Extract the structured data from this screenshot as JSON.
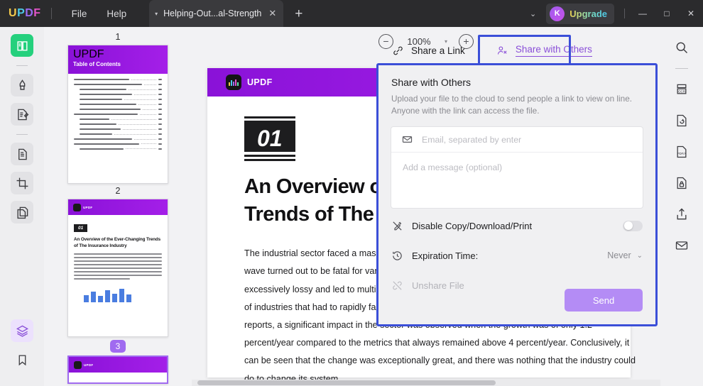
{
  "titlebar": {
    "logo": [
      "U",
      "P",
      "D",
      "F"
    ],
    "menus": [
      {
        "label": "File",
        "name": "menu-file"
      },
      {
        "label": "Help",
        "name": "menu-help"
      }
    ],
    "tab": {
      "name": "Helping-Out...al-Strength",
      "close": "✕",
      "caret": "▾"
    },
    "new_tab": "+",
    "chevron": "⌄",
    "account_initial": "K",
    "upgrade_label": "Upgrade",
    "window_buttons": {
      "minimize": "—",
      "maximize": "□",
      "close": "✕"
    }
  },
  "left_rail": {
    "items": [
      {
        "name": "sidebar-reader-icon",
        "state": "active"
      },
      {
        "name": "sidebar-annotate-icon",
        "state": "normal"
      },
      {
        "name": "sidebar-edit-pdf-icon",
        "state": "normal"
      },
      {
        "name": "sidebar-organize-pages-icon",
        "state": "normal"
      },
      {
        "name": "sidebar-crop-icon",
        "state": "normal"
      },
      {
        "name": "sidebar-convert-icon",
        "state": "normal"
      }
    ],
    "bottom": [
      {
        "name": "sidebar-layers-icon",
        "state": "purple"
      },
      {
        "name": "sidebar-bookmark-icon",
        "state": "plain"
      }
    ]
  },
  "right_rail": {
    "items": [
      {
        "name": "search-icon"
      },
      {
        "name": "ocr-icon"
      },
      {
        "name": "convert-pdf-icon"
      },
      {
        "name": "pdf-a-icon"
      },
      {
        "name": "protect-icon"
      },
      {
        "name": "share-export-icon"
      },
      {
        "name": "email-icon"
      }
    ]
  },
  "thumbnails": {
    "pages": [
      {
        "number": "1",
        "selected": false,
        "kind": "toc"
      },
      {
        "number": "2",
        "selected": false,
        "kind": "content"
      },
      {
        "number": "3",
        "selected": true,
        "kind": "content"
      }
    ],
    "toc_title": "Table of Contents",
    "mini_badge": "01",
    "mini_headline": "An Overview of the Ever-Changing Trends of The Insurance Industry"
  },
  "toolbar": {
    "zoom_out": "−",
    "zoom_level": "100%",
    "zoom_caret": "▾",
    "zoom_in": "+"
  },
  "document": {
    "brand": "UPDF",
    "section_number": "01",
    "headline_line1": "An Overview of the Ever-Changing",
    "headline_line2": "Trends of The Insurance Industry",
    "body": "The industrial sector faced a massive tremor with the advent of the COVID-19 wave. The deadly wave turned out to be fatal for various industries, where the pandemic panic and clampdown was excessively lossy and led to multiple changes in the sector. The line is evidently concerning the list of industries that had to rapidly face the effects caused by the pandemic. According to a recent reports, a significant impact in the sector was observed when the growth was of only 1.2 percent/year compared to the metrics that always remained above 4 percent/year. Conclusively, it can be seen that the change was exceptionally great, and there was nothing that the industry could do to change its system."
  },
  "share": {
    "tabs": [
      {
        "label": "Share a Link",
        "icon": "link-icon",
        "active": false
      },
      {
        "label": "Share with Others",
        "icon": "share-people-icon",
        "active": true
      }
    ],
    "title": "Share with Others",
    "subtitle": "Upload your file to the cloud to send people a link to view on line. Anyone with the link can access the file.",
    "email_placeholder": "Email, separated by enter",
    "email_value": "",
    "message_placeholder": "Add a message (optional)",
    "message_value": "",
    "disable_copy_label": "Disable Copy/Download/Print",
    "disable_copy_state": "off",
    "expiration_label": "Expiration Time:",
    "expiration_value": "Never",
    "expiration_caret": "⌄",
    "unshare_label": "Unshare File",
    "unshare_enabled": false,
    "send_label": "Send"
  },
  "colors": {
    "accent_purple": "#8a4fd8",
    "annotation_blue": "#3b4fd8",
    "brand_purple": "#a41fe8",
    "active_green": "#25d07d",
    "send_button": "#b48cf5"
  }
}
